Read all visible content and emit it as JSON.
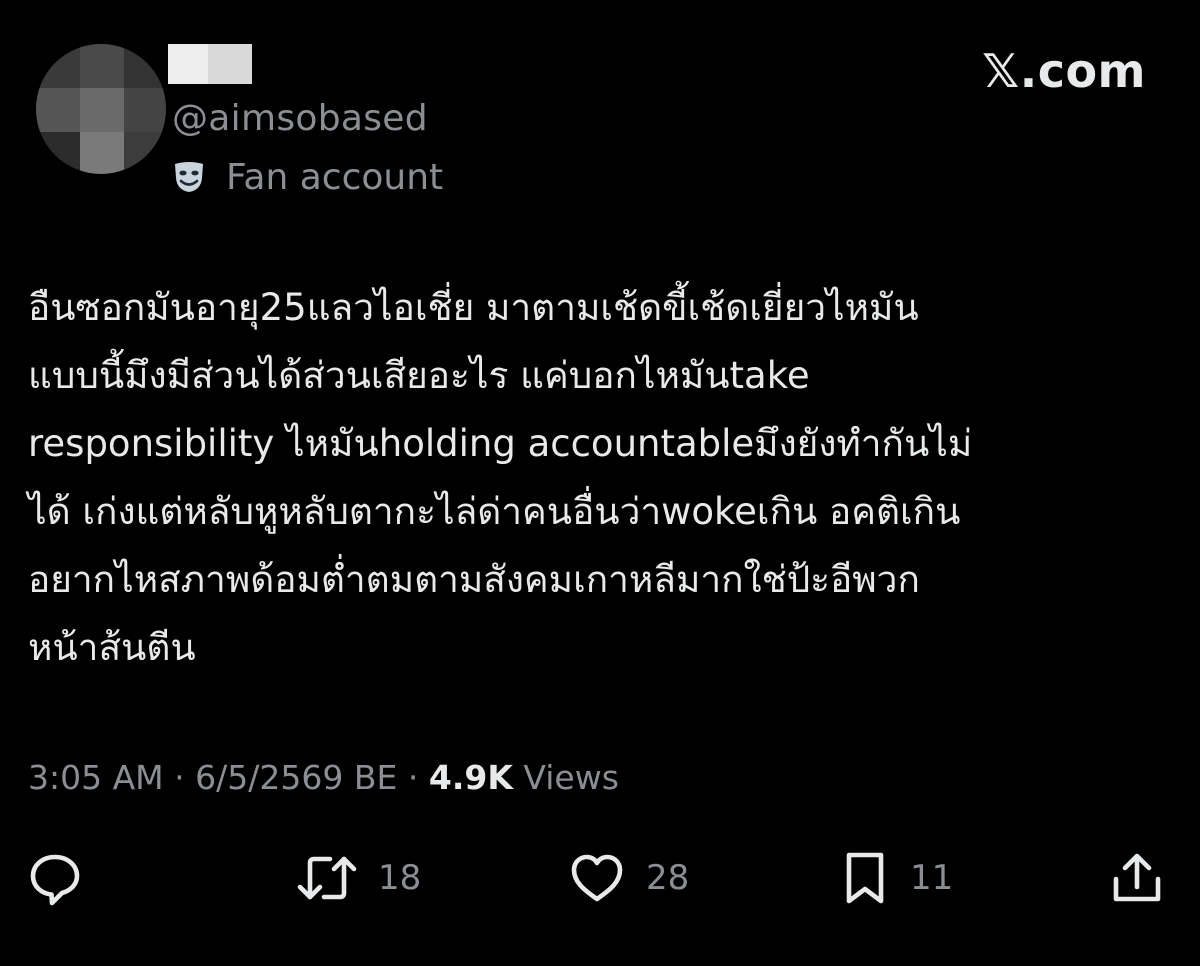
{
  "header": {
    "handle": "@aimsobased",
    "account_label": "Fan account",
    "account_label_icon": "theater-mask-icon",
    "watermark": "𝕏.com"
  },
  "tweet": {
    "lines": [
      "อืนซอกมันอายุ25แลวไอเชี่ย มาตามเช้ดขี้เช้ดเยี่ยวไหมัน",
      "แบบนี้มึงมีส่วนได้ส่วนเสียอะไร แค่บอกไหมันtake",
      "responsibility ไหมันholding accountableมึงยังทำกันไม่",
      "ได้ เก่งแต่หลับหูหลับตากะไล่ด่าคนอื่นว่าwokeเกิน อคติเกิน",
      "อยากไหสภาพด้อมต่ำตมตามสังคมเกาหลีมากใช่ป้ะอีพวก",
      "หน้าส้นตีน"
    ]
  },
  "meta": {
    "time": "3:05 AM",
    "sep1": "·",
    "date": "6/5/2569 BE",
    "sep2": "·",
    "views_count": "4.9K",
    "views_label": "Views"
  },
  "actions": {
    "reply": {
      "icon": "reply-icon",
      "count": ""
    },
    "retweet": {
      "icon": "retweet-icon",
      "count": "18"
    },
    "like": {
      "icon": "heart-icon",
      "count": "28"
    },
    "bookmark": {
      "icon": "bookmark-icon",
      "count": "11"
    },
    "share": {
      "icon": "share-icon",
      "count": ""
    }
  },
  "colors": {
    "background": "#000000",
    "text_primary": "#e7e9ea",
    "text_secondary": "#8b8f94"
  }
}
